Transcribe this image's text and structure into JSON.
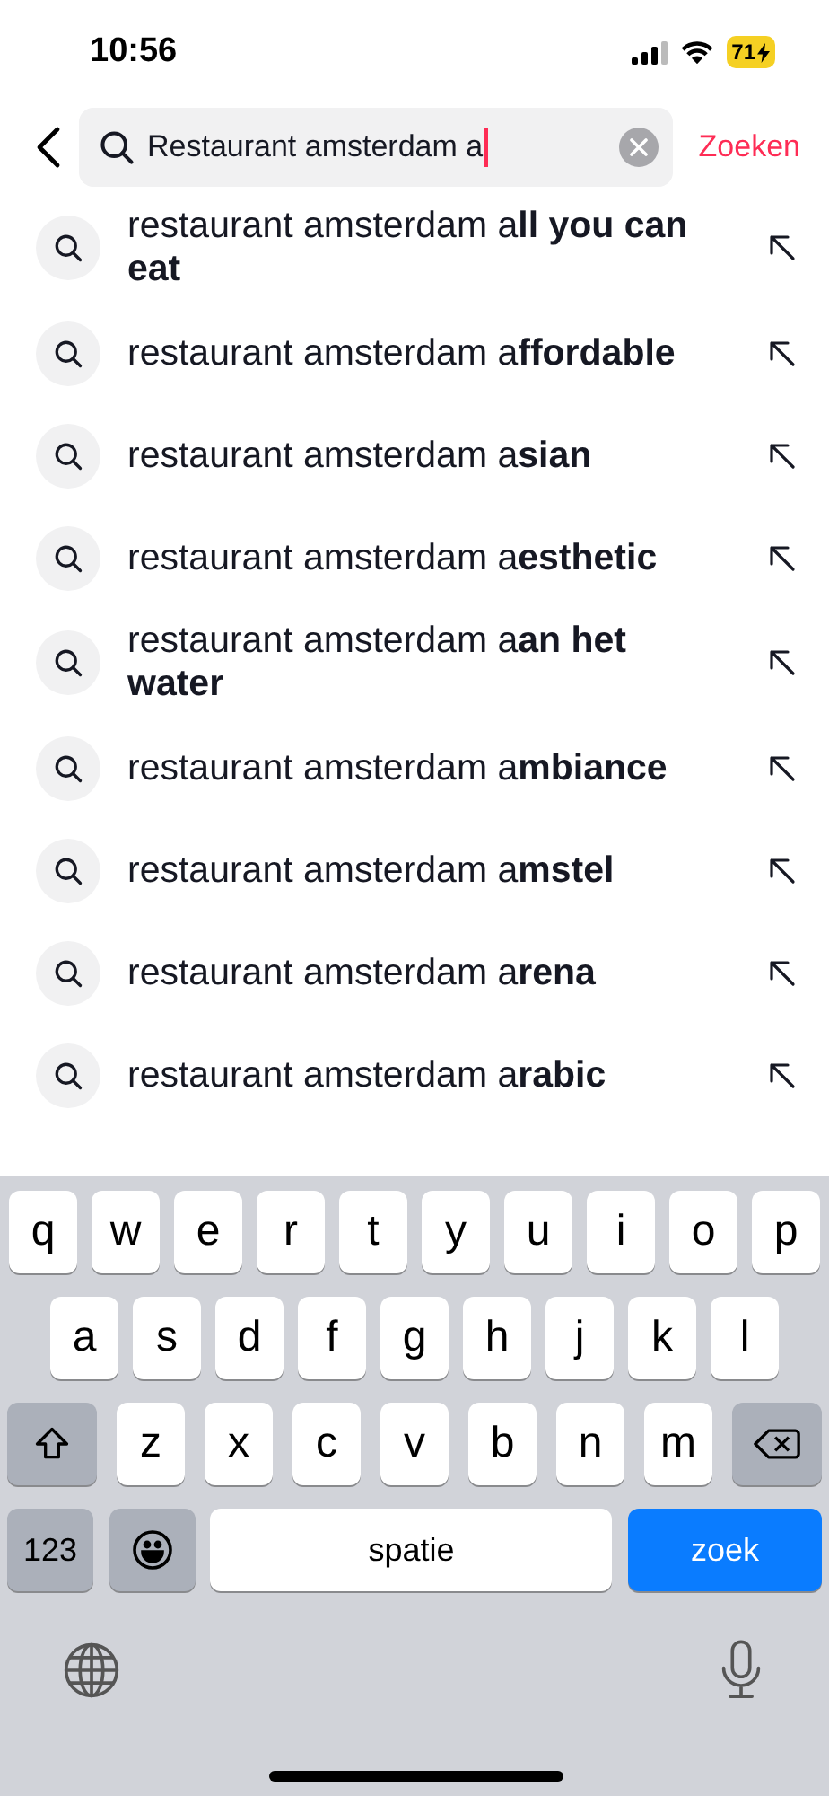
{
  "status_bar": {
    "time": "10:56",
    "battery": "71"
  },
  "search": {
    "value": "Restaurant amsterdam a",
    "action": "Zoeken"
  },
  "suggestions": [
    {
      "text": "restaurant amsterdam a**ll you can eat**"
    },
    {
      "text": "restaurant amsterdam a**ffordable**"
    },
    {
      "text": "restaurant amsterdam a**sian**"
    },
    {
      "text": "restaurant amsterdam a**esthetic**"
    },
    {
      "text": "restaurant amsterdam a**an het water**"
    },
    {
      "text": "restaurant amsterdam a**mbiance**"
    },
    {
      "text": "restaurant amsterdam a**mstel**"
    },
    {
      "text": "restaurant amsterdam a**rena**"
    },
    {
      "text": "restaurant amsterdam a**rabic**"
    }
  ],
  "keyboard": {
    "key_rows": [
      {
        "keys": [
          {
            "kind": "letter",
            "label": "q"
          },
          {
            "kind": "letter",
            "label": "w"
          },
          {
            "kind": "letter",
            "label": "e"
          },
          {
            "kind": "letter",
            "label": "r"
          },
          {
            "kind": "letter",
            "label": "t"
          },
          {
            "kind": "letter",
            "label": "y"
          },
          {
            "kind": "letter",
            "label": "u"
          },
          {
            "kind": "letter",
            "label": "i"
          },
          {
            "kind": "letter",
            "label": "o"
          },
          {
            "kind": "letter",
            "label": "p"
          }
        ]
      },
      {
        "keys": [
          {
            "kind": "letter",
            "label": "a"
          },
          {
            "kind": "letter",
            "label": "s"
          },
          {
            "kind": "letter",
            "label": "d"
          },
          {
            "kind": "letter",
            "label": "f"
          },
          {
            "kind": "letter",
            "label": "g"
          },
          {
            "kind": "letter",
            "label": "h"
          },
          {
            "kind": "letter",
            "label": "j"
          },
          {
            "kind": "letter",
            "label": "k"
          },
          {
            "kind": "letter",
            "label": "l"
          }
        ]
      },
      {
        "keys": [
          {
            "kind": "shift"
          },
          {
            "kind": "letter",
            "label": "z"
          },
          {
            "kind": "letter",
            "label": "x"
          },
          {
            "kind": "letter",
            "label": "c"
          },
          {
            "kind": "letter",
            "label": "v"
          },
          {
            "kind": "letter",
            "label": "b"
          },
          {
            "kind": "letter",
            "label": "n"
          },
          {
            "kind": "letter",
            "label": "m"
          },
          {
            "kind": "backspace"
          }
        ]
      },
      {
        "keys": [
          {
            "kind": "numbers",
            "label": "123"
          },
          {
            "kind": "emoji"
          },
          {
            "kind": "space",
            "label": "spatie"
          },
          {
            "kind": "action",
            "label": "zoek"
          }
        ]
      }
    ]
  }
}
